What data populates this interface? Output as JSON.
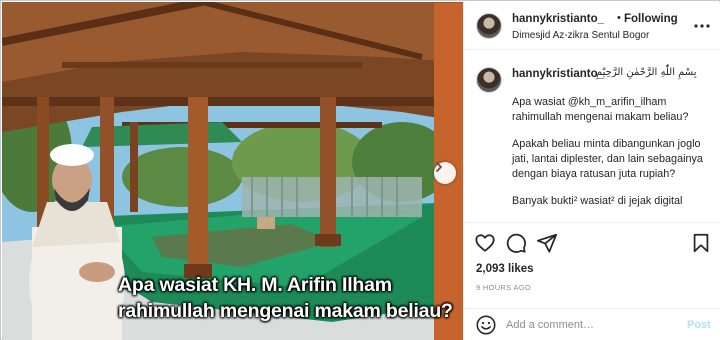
{
  "media": {
    "caption": "Apa wasiat KH. M. Arifin Ilham rahimullah mengenai makam beliau?",
    "next_icon": "chevron-right-icon"
  },
  "post_header": {
    "username": "hannykristianto_",
    "separator": "•",
    "follow_status": "Following",
    "location": "Dimesjid Az-zikra Sentul Bogor",
    "more_icon": "more-dots-icon"
  },
  "caption_comment": {
    "username": "hannykristianto_",
    "arabic": "بِسْمِ اللّٰهِ الرَّحْمٰنِ الرَّحِيْمِ",
    "paragraphs": [
      "Apa wasiat @kh_m_arifin_ilham rahimullah mengenai makam beliau?",
      "Apakah beliau minta dibangunkan joglo jati, lantai diplester, dan lain sebagainya dengan biaya ratusan juta rupiah?",
      "Banyak bukti² wasiat² di jejak digital"
    ]
  },
  "actions": {
    "like_icon": "heart-icon",
    "comment_icon": "comment-icon",
    "share_icon": "share-icon",
    "save_icon": "bookmark-icon"
  },
  "stats": {
    "likes": "2,093 likes",
    "time": "9 HOURS AGO"
  },
  "add_comment": {
    "emoji_icon": "emoji-icon",
    "placeholder": "Add a comment…",
    "post_label": "Post"
  },
  "colors": {
    "post_button_disabled": "#b2dffc",
    "text_primary": "#262626",
    "text_secondary": "#8e8e8e",
    "divider": "#efefef"
  }
}
